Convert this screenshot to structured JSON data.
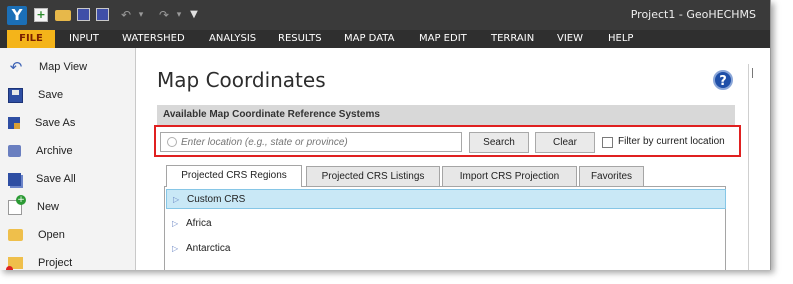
{
  "window": {
    "title": "Project1 - GeoHECHMS",
    "logo": "Y"
  },
  "menu": {
    "items": [
      "FILE",
      "INPUT",
      "WATERSHED",
      "ANALYSIS",
      "RESULTS",
      "MAP DATA",
      "MAP EDIT",
      "TERRAIN",
      "VIEW",
      "HELP"
    ]
  },
  "sidebar": {
    "items": [
      {
        "label": "Map View",
        "icon": "map-view-icon"
      },
      {
        "label": "Save",
        "icon": "save-icon"
      },
      {
        "label": "Save As",
        "icon": "save-as-icon"
      },
      {
        "label": "Archive",
        "icon": "archive-icon"
      },
      {
        "label": "Save All",
        "icon": "save-all-icon"
      },
      {
        "label": "New",
        "icon": "new-icon"
      },
      {
        "label": "Open",
        "icon": "open-folder-icon"
      },
      {
        "label": "Project",
        "icon": "close-project-icon"
      }
    ]
  },
  "main": {
    "title": "Map Coordinates",
    "section_header": "Available Map Coordinate Reference Systems",
    "search": {
      "placeholder": "Enter location (e.g., state or province)",
      "search_label": "Search",
      "clear_label": "Clear",
      "filter_label": "Filter by current location",
      "filter_checked": false
    },
    "tabs": [
      {
        "label": "Projected CRS Regions",
        "active": true
      },
      {
        "label": "Projected CRS Listings",
        "active": false
      },
      {
        "label": "Import CRS Projection",
        "active": false
      },
      {
        "label": "Favorites",
        "active": false
      }
    ],
    "tree": [
      {
        "label": "Custom CRS",
        "selected": true
      },
      {
        "label": "Africa",
        "selected": false
      },
      {
        "label": "Antarctica",
        "selected": false
      }
    ]
  },
  "colors": {
    "file_tab": "#f4b41a",
    "menubar": "#2f2f2f",
    "highlight_border": "#e02020",
    "selected_row": "#c9e8f6"
  }
}
